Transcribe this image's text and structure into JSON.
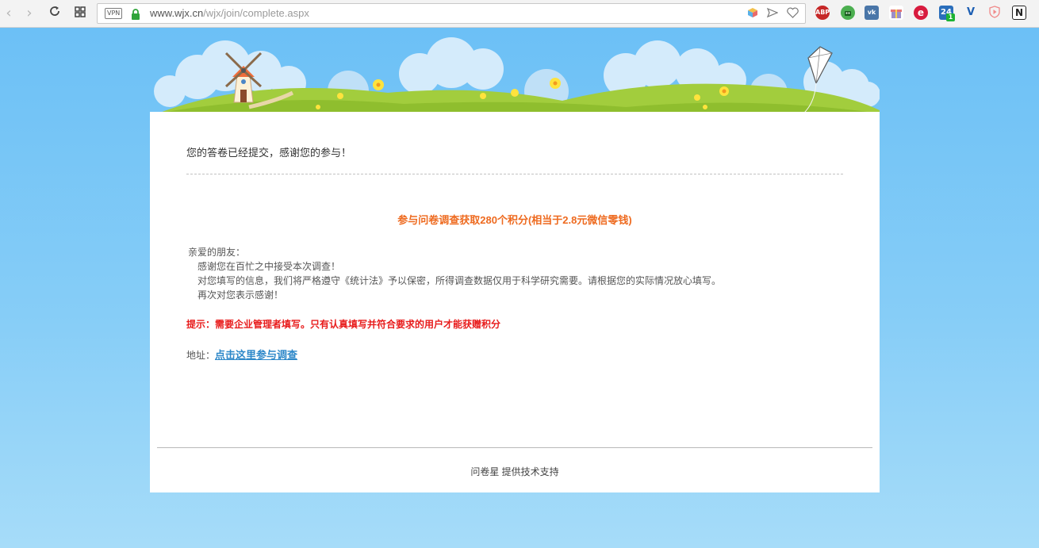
{
  "browser": {
    "url_host": "www.wjx.cn",
    "url_path": "/wjx/join/complete.aspx",
    "vpn_label": "VPN",
    "nav_icons": [
      "back-icon",
      "forward-icon",
      "reload-icon",
      "grid-icon"
    ],
    "url_icons": [
      "cube-icon",
      "send-icon",
      "heart-icon"
    ],
    "extensions": [
      {
        "name": "adblock-plus",
        "label": "ABP",
        "color": "#c62828"
      },
      {
        "name": "android-ext",
        "label": "",
        "color": "#4caf50"
      },
      {
        "name": "vk-ext",
        "label": "",
        "color": "#4a76a8"
      },
      {
        "name": "gift-ext",
        "label": "",
        "color": "#9c8fc9"
      },
      {
        "name": "e-ext",
        "label": "e",
        "color": "#d81b3e"
      },
      {
        "name": "24-ext",
        "label": "24",
        "color": "#2a6ebb",
        "badge": "1"
      },
      {
        "name": "v-ext",
        "label": "",
        "color": "#1d5fb3"
      },
      {
        "name": "shield-ext",
        "label": "",
        "color": "#f09090"
      },
      {
        "name": "n-ext",
        "label": "N",
        "color": "#333333"
      }
    ]
  },
  "page": {
    "thanks": "您的答卷已经提交，感谢您的参与！",
    "reward": "参与问卷调查获取280个积分(相当于2.8元微信零钱)",
    "letter": [
      "亲爱的朋友：",
      "感谢您在百忙之中接受本次调查！",
      "对您填写的信息，我们将严格遵守《统计法》予以保密，所得调查数据仅用于科学研究需要。请根据您的实际情况放心填写。",
      "再次对您表示感谢！"
    ],
    "tip": "提示：需要企业管理者填写。只有认真填写并符合要求的用户才能获赠积分",
    "address_label": "地址：",
    "address_link": "点击这里参与调查",
    "footer": "问卷星 提供技术支持"
  },
  "colors": {
    "reward": "#ee6a1f",
    "tip": "#e81c1c",
    "link": "#2e88c9",
    "sky": "#6cc0f6"
  }
}
